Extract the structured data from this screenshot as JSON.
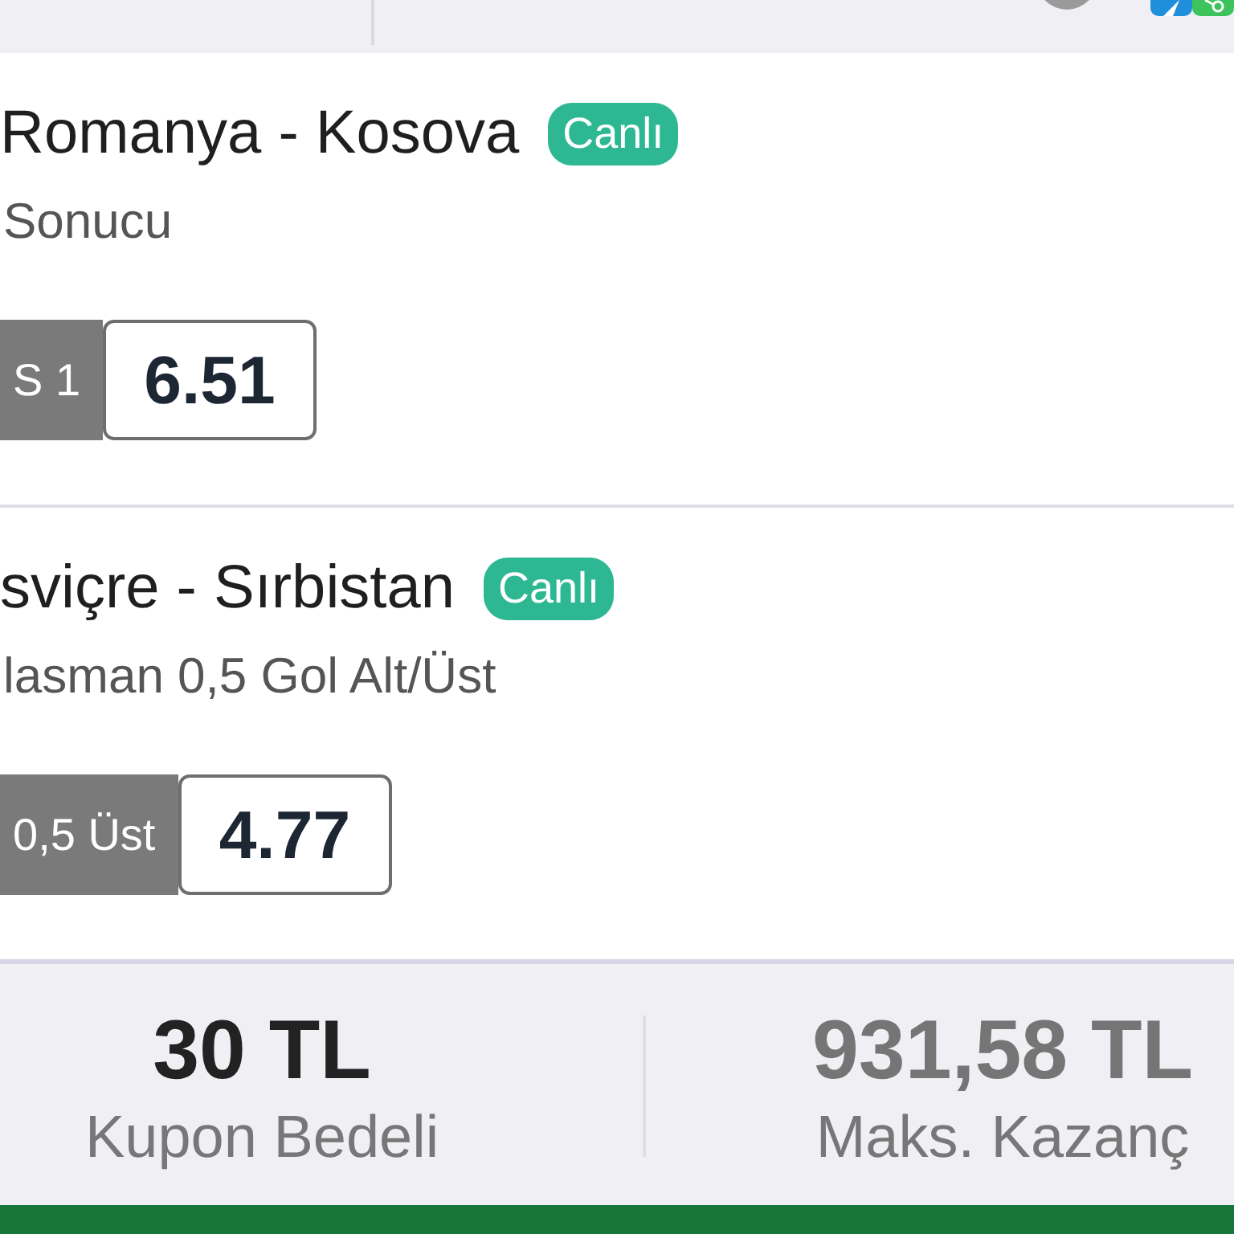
{
  "bets": [
    {
      "match": "Romanya - Kosova",
      "live_badge": "Canlı",
      "market": "Sonucu",
      "selection": "S 1",
      "odds": "6.51"
    },
    {
      "match": "sviçre - Sırbistan",
      "live_badge": "Canlı",
      "market": "lasman 0,5 Gol Alt/Üst",
      "selection": "0,5 Üst",
      "odds": "4.77"
    }
  ],
  "summary": {
    "stake": "30 TL",
    "stake_label": "Kupon Bedeli",
    "max_win": "931,58 TL",
    "max_win_label": "Maks. Kazanç"
  }
}
